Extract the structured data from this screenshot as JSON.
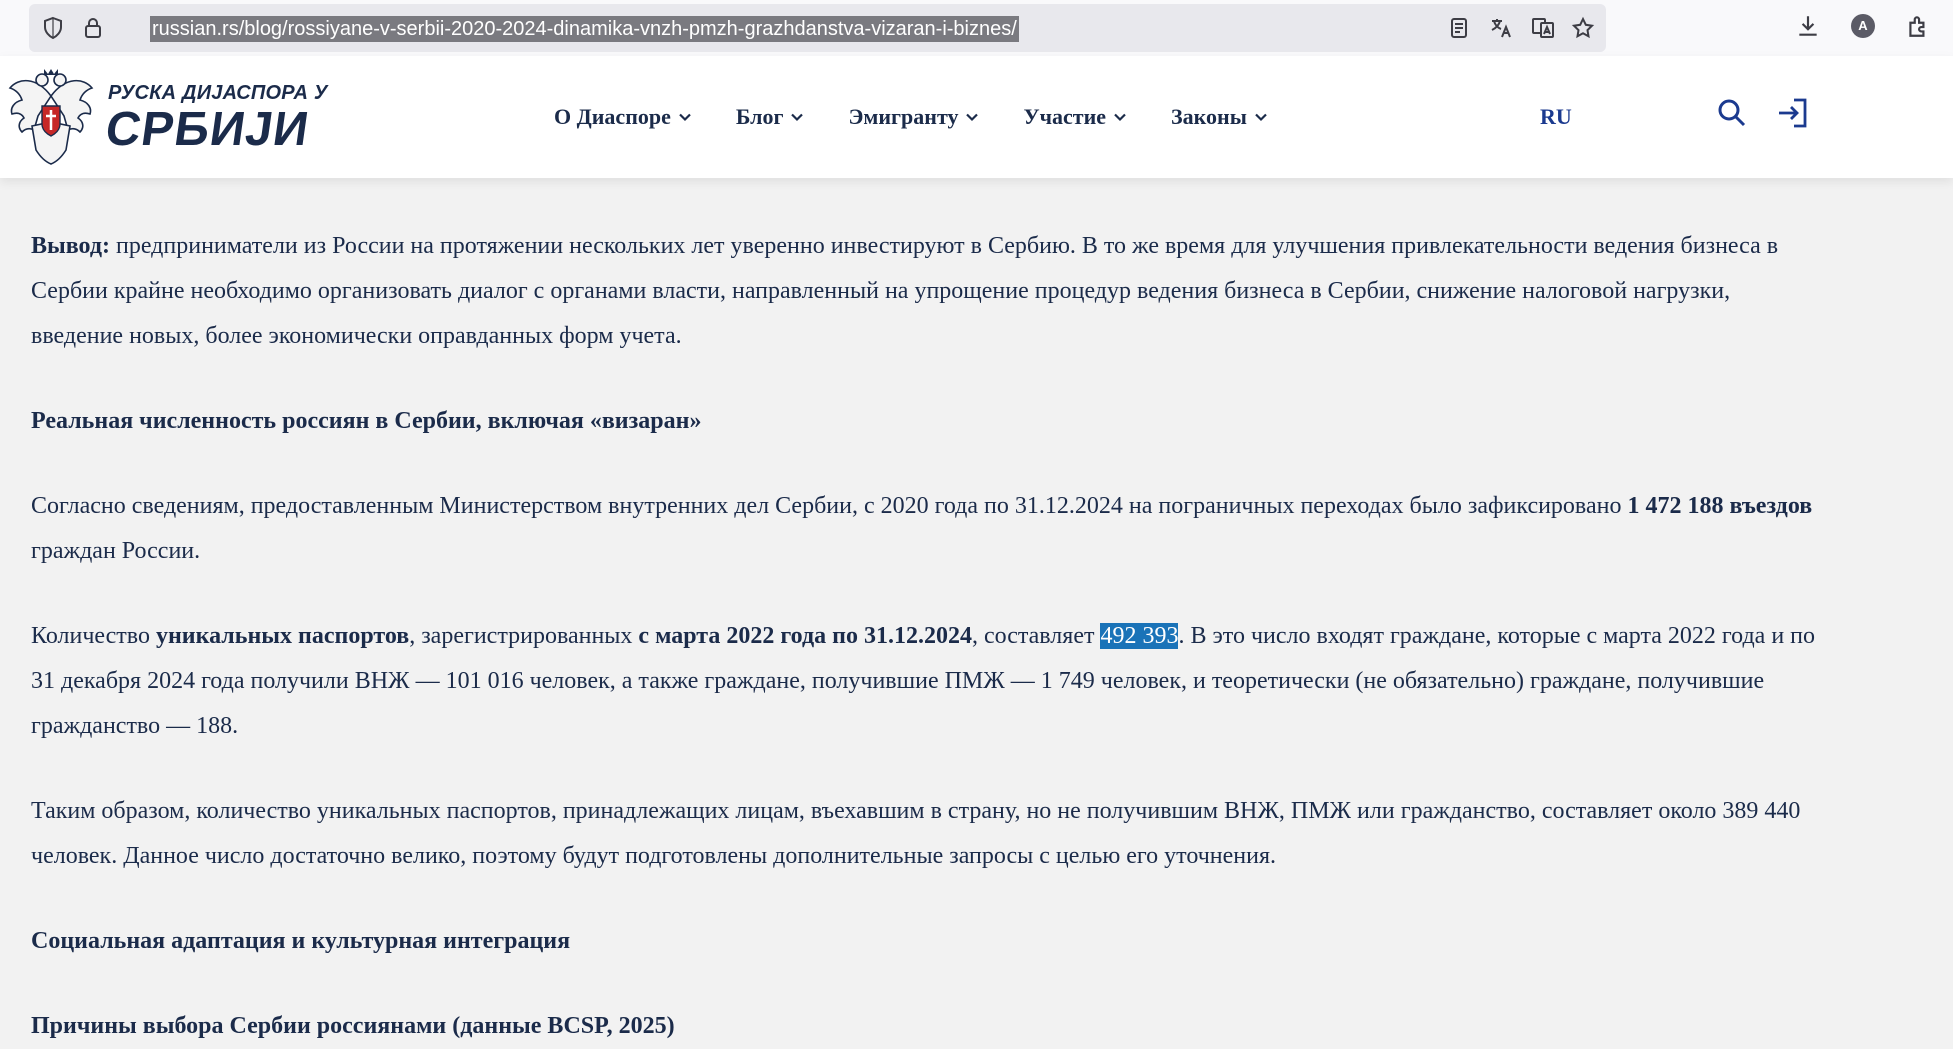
{
  "browser": {
    "url": "russian.rs/blog/rossiyane-v-serbii-2020-2024-dinamika-vnzh-pmzh-grazhdanstva-vizaran-i-biznes/",
    "avatar_letter": "A",
    "icons": [
      "shield-icon",
      "lock-icon",
      "reader-view-icon",
      "translate-icon",
      "page-translate-icon",
      "bookmark-star-icon",
      "download-icon",
      "extensions-icon"
    ]
  },
  "header": {
    "logo_line1": "РУСКА ДИЈАСПОРА У",
    "logo_line2": "СРБИЈИ",
    "nav": [
      {
        "label": "О Диаспоре"
      },
      {
        "label": "Блог"
      },
      {
        "label": "Эмигранту"
      },
      {
        "label": "Участие"
      },
      {
        "label": "Законы"
      }
    ],
    "lang": "RU",
    "icons": [
      "search-icon",
      "login-icon"
    ]
  },
  "article": {
    "p1_bold": "Вывод:",
    "p1_text": " предприниматели из России на протяжении нескольких лет уверенно инвестируют в Сербию. В то же время для улучшения привлекательности ведения бизнеса в Сербии крайне необходимо организовать диалог с органами власти, направленный на упрощение процедур ведения бизнеса в Сербии, снижение налоговой нагрузки, введение новых, более экономически оправданных форм учета.",
    "h1": "Реальная численность россиян в Сербии, включая «визаран»",
    "p2_a": "Согласно сведениям, предоставленным Министерством внутренних дел Сербии, с 2020 года по 31.12.2024 на пограничных переходах было зафиксировано ",
    "p2_b": "1 472 188 въездов",
    "p2_c": " граждан России.",
    "p3_a": "Количество ",
    "p3_b": "уникальных паспортов",
    "p3_c": ", зарегистрированных ",
    "p3_d": "с марта 2022 года по 31.12.2024",
    "p3_e": ", составляет ",
    "p3_hl": "492 393",
    "p3_f": ". В это число входят граждане, которые с марта 2022 года и по 31 декабря 2024 года получили ВНЖ — 101 016 человек, а также граждане, получившие ПМЖ — 1 749 человек, и теоретически (не обязательно) граждане, получившие гражданство — 188.",
    "p4": "Таким образом, количество уникальных паспортов, принадлежащих лицам, въехавшим в страну, но не получившим ВНЖ, ПМЖ или гражданство, составляет около 389 440 человек. Данное число достаточно велико, поэтому будут подготовлены дополнительные запросы с целью его уточнения.",
    "h2": "Социальная адаптация и культурная интеграция",
    "h3": "Причины выбора Сербии россиянами (данные BCSP, 2025)"
  },
  "colors": {
    "brand": "#1b2b4a",
    "accent": "#1b3a8f",
    "highlight": "#1a73b8",
    "page_bg": "#f2f2f2"
  }
}
